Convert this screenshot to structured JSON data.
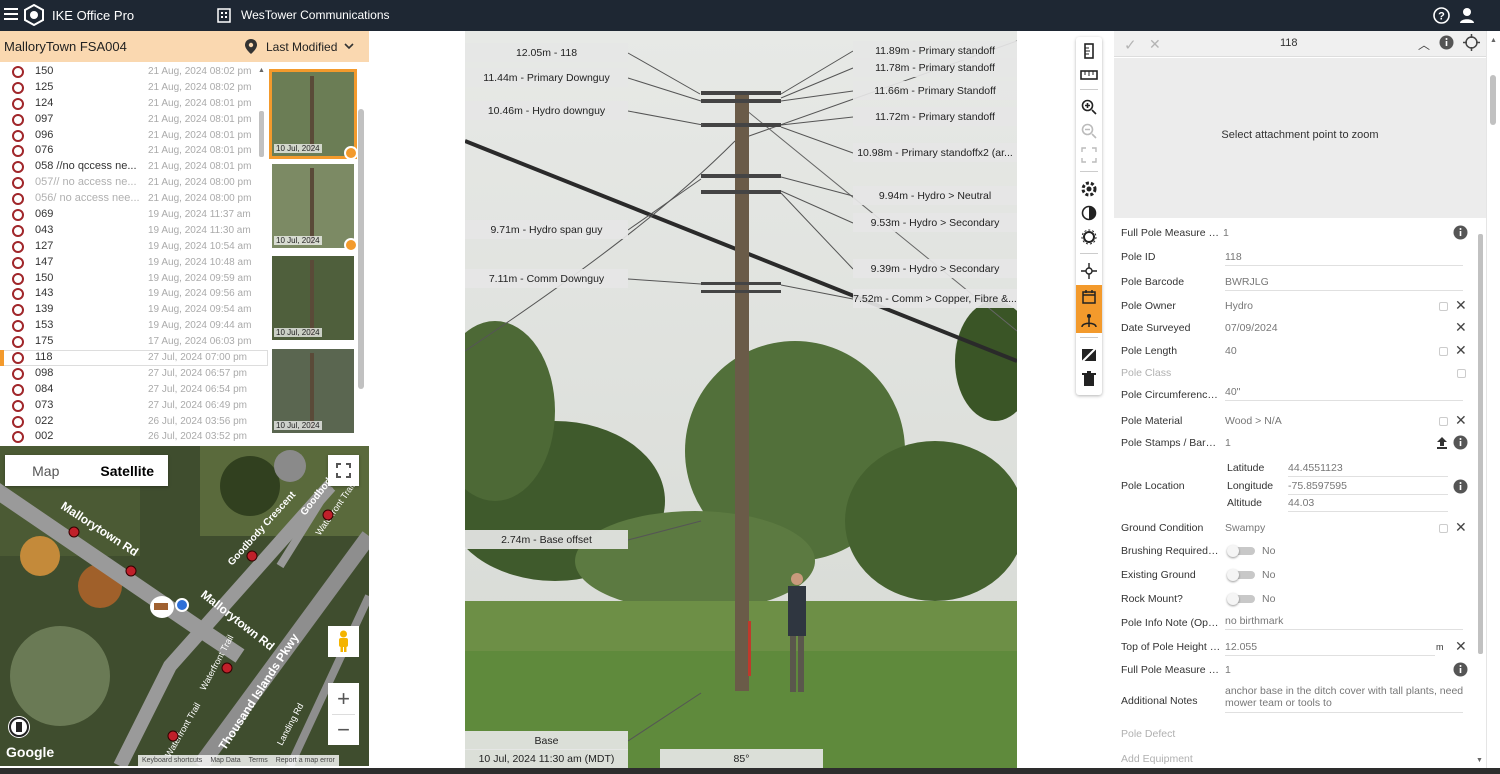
{
  "topbar": {
    "app_title": "IKE Office Pro",
    "org_name": "WesTower Communications"
  },
  "left_header": {
    "project": "MalloryTown FSA004",
    "sort_label": "Last Modified"
  },
  "poles": [
    {
      "id": "150",
      "date": "21 Aug, 2024 08:02 pm",
      "dim": false
    },
    {
      "id": "125",
      "date": "21 Aug, 2024 08:02 pm",
      "dim": false
    },
    {
      "id": "124",
      "date": "21 Aug, 2024 08:01 pm",
      "dim": false
    },
    {
      "id": "097",
      "date": "21 Aug, 2024 08:01 pm",
      "dim": false
    },
    {
      "id": "096",
      "date": "21 Aug, 2024 08:01 pm",
      "dim": false
    },
    {
      "id": "076",
      "date": "21 Aug, 2024 08:01 pm",
      "dim": false
    },
    {
      "id": "058 //no qccess ne...",
      "date": "21 Aug, 2024 08:01 pm",
      "dim": false
    },
    {
      "id": "057// no access ne...",
      "date": "21 Aug, 2024 08:00 pm",
      "dim": true
    },
    {
      "id": "056/ no access nee...",
      "date": "21 Aug, 2024 08:00 pm",
      "dim": true
    },
    {
      "id": "069",
      "date": "19 Aug, 2024 11:37 am",
      "dim": false
    },
    {
      "id": "043",
      "date": "19 Aug, 2024 11:30 am",
      "dim": false
    },
    {
      "id": "127",
      "date": "19 Aug, 2024 10:54 am",
      "dim": false
    },
    {
      "id": "147",
      "date": "19 Aug, 2024 10:48 am",
      "dim": false
    },
    {
      "id": "150",
      "date": "19 Aug, 2024 09:59 am",
      "dim": false
    },
    {
      "id": "143",
      "date": "19 Aug, 2024 09:56 am",
      "dim": false
    },
    {
      "id": "139",
      "date": "19 Aug, 2024 09:54 am",
      "dim": false
    },
    {
      "id": "153",
      "date": "19 Aug, 2024 09:44 am",
      "dim": false
    },
    {
      "id": "175",
      "date": "17 Aug, 2024 06:03 pm",
      "dim": false
    },
    {
      "id": "118",
      "date": "27 Jul, 2024 07:00 pm",
      "dim": false,
      "selected": true
    },
    {
      "id": "098",
      "date": "27 Jul, 2024 06:57 pm",
      "dim": false
    },
    {
      "id": "084",
      "date": "27 Jul, 2024 06:54 pm",
      "dim": false
    },
    {
      "id": "073",
      "date": "27 Jul, 2024 06:49 pm",
      "dim": false
    },
    {
      "id": "022",
      "date": "26 Jul, 2024 03:56 pm",
      "dim": false
    },
    {
      "id": "002",
      "date": "26 Jul, 2024 03:52 pm",
      "dim": false
    }
  ],
  "thumbnails": [
    {
      "date": "10 Jul, 2024",
      "badge": true,
      "active": true
    },
    {
      "date": "10 Jul, 2024",
      "badge": true,
      "active": false
    },
    {
      "date": "10 Jul, 2024",
      "badge": false,
      "active": false
    },
    {
      "date": "10 Jul, 2024",
      "badge": false,
      "active": false
    }
  ],
  "map": {
    "type_map": "Map",
    "type_satellite": "Satellite",
    "streets": [
      "Mallorytown Rd",
      "Mallorytown Rd",
      "Goodbody Crescent",
      "Goodbody",
      "Waterfront Trail",
      "Waterfront Trail",
      "Thousand Islands Pkwy",
      "Landing Rd",
      "Waterfront Trail"
    ],
    "google": "Google",
    "attributions": [
      "Keyboard shortcuts",
      "Map Data",
      "Terms",
      "Report a map error"
    ]
  },
  "measurements_left": [
    "12.05m - 118",
    "11.44m - Primary Downguy",
    "10.46m - Hydro downguy",
    "9.71m - Hydro span guy",
    "7.11m - Comm Downguy",
    "2.74m - Base offset",
    "Base"
  ],
  "measurements_right": [
    "11.89m - Primary standoff",
    "11.78m - Primary standoff",
    "11.66m - Primary Standoff",
    "11.72m - Primary standoff",
    "10.98m - Primary standoffx2 (ar...",
    "9.94m - Hydro > Neutral",
    "9.53m - Hydro > Secondary",
    "9.39m - Hydro > Secondary",
    "7.52m - Comm > Copper, Fibre &..."
  ],
  "photo_footer": {
    "datetime": "10 Jul, 2024 11:30 am (MDT)",
    "angle": "85°"
  },
  "detail": {
    "pole_title": "118",
    "zoom_hint": "Select attachment point to zoom",
    "fields": {
      "full_measure1_label": "Full Pole Measure 1 (F...",
      "full_measure1_value": "1",
      "pole_id_label": "Pole ID",
      "pole_id_value": "118",
      "barcode_label": "Pole Barcode",
      "barcode_value": "BWRJLG",
      "owner_label": "Pole Owner",
      "owner_value": "Hydro",
      "date_label": "Date Surveyed",
      "date_value": "07/09/2024",
      "length_label": "Pole Length",
      "length_value": "40",
      "class_label": "Pole Class",
      "circ_label": "Pole Circumference (...",
      "circ_value": "40\"",
      "material_label": "Pole Material",
      "material_value": "Wood > N/A",
      "stamps_label": "Pole Stamps / Barcod...",
      "stamps_value": "1",
      "location_label": "Pole Location",
      "lat_label": "Latitude",
      "lat_value": "44.4551123",
      "lon_label": "Longitude",
      "lon_value": "-75.8597595",
      "alt_label": "Altitude",
      "alt_value": "44.03",
      "ground_label": "Ground Condition",
      "ground_value": "Swampy",
      "brushing_label": "Brushing Required at ...",
      "brushing_value": "No",
      "existing_ground_label": "Existing Ground",
      "existing_ground_value": "No",
      "rock_label": "Rock Mount?",
      "rock_value": "No",
      "info_note_label": "Pole Info Note (Optio...",
      "info_note_value": "no birthmark",
      "top_height_label": "Top of Pole Height (O...",
      "top_height_value": "12.055",
      "top_height_unit": "m",
      "full_measure2_label": "Full Pole Measure #2 ...",
      "full_measure2_value": "1",
      "notes_label": "Additional Notes",
      "notes_value_1": "anchor base in the ditch cover with tall plants, need a",
      "notes_value_2": "mower team or tools to",
      "defect_label": "Pole Defect",
      "add_equipment_label": "Add Equipment"
    }
  },
  "colors": {
    "topbar": "#1e2733",
    "accent": "#f39a2c",
    "header_bg": "#fad8b0",
    "pole_circle": "#a0262a"
  }
}
